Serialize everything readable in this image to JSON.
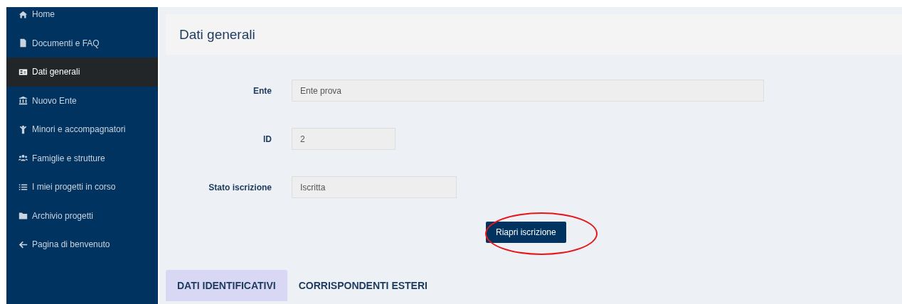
{
  "sidebar": {
    "items": [
      {
        "label": "Home",
        "selected": false
      },
      {
        "label": "Documenti e FAQ",
        "selected": false
      },
      {
        "label": "Dati generali",
        "selected": true
      },
      {
        "label": "Nuovo Ente",
        "selected": false
      },
      {
        "label": "Minori e accompagnatori",
        "selected": false
      },
      {
        "label": "Famiglie e strutture",
        "selected": false
      },
      {
        "label": "I miei progetti in corso",
        "selected": false
      },
      {
        "label": "Archivio progetti",
        "selected": false
      },
      {
        "label": "Pagina di benvenuto",
        "selected": false
      }
    ]
  },
  "page_title": "Dati generali",
  "form": {
    "fields": [
      {
        "label": "Ente",
        "value": "Ente prova"
      },
      {
        "label": "ID",
        "value": "2"
      },
      {
        "label": "Stato iscrizione",
        "value": "Iscritta"
      }
    ],
    "button": "Riapri iscrizione"
  },
  "tabs": [
    {
      "label": "DATI IDENTIFICATIVI",
      "selected": true
    },
    {
      "label": "CORRISPONDENTI ESTERI",
      "selected": false
    }
  ]
}
